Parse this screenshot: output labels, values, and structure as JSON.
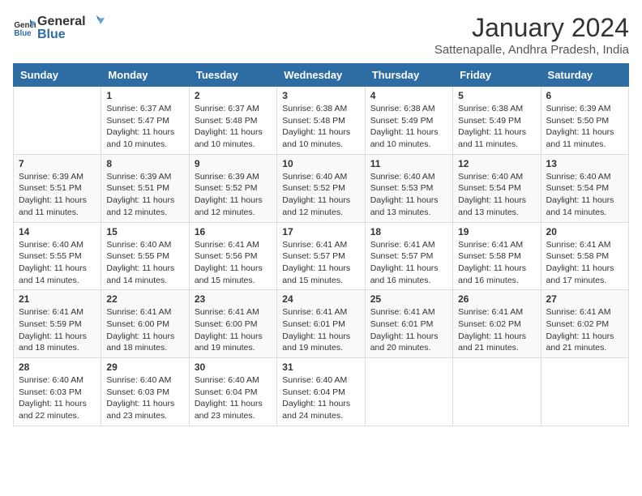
{
  "logo": {
    "text_general": "General",
    "text_blue": "Blue"
  },
  "title": "January 2024",
  "subtitle": "Sattenapalle, Andhra Pradesh, India",
  "days_of_week": [
    "Sunday",
    "Monday",
    "Tuesday",
    "Wednesday",
    "Thursday",
    "Friday",
    "Saturday"
  ],
  "weeks": [
    [
      {
        "day": "",
        "sunrise": "",
        "sunset": "",
        "daylight": ""
      },
      {
        "day": "1",
        "sunrise": "Sunrise: 6:37 AM",
        "sunset": "Sunset: 5:47 PM",
        "daylight": "Daylight: 11 hours and 10 minutes."
      },
      {
        "day": "2",
        "sunrise": "Sunrise: 6:37 AM",
        "sunset": "Sunset: 5:48 PM",
        "daylight": "Daylight: 11 hours and 10 minutes."
      },
      {
        "day": "3",
        "sunrise": "Sunrise: 6:38 AM",
        "sunset": "Sunset: 5:48 PM",
        "daylight": "Daylight: 11 hours and 10 minutes."
      },
      {
        "day": "4",
        "sunrise": "Sunrise: 6:38 AM",
        "sunset": "Sunset: 5:49 PM",
        "daylight": "Daylight: 11 hours and 10 minutes."
      },
      {
        "day": "5",
        "sunrise": "Sunrise: 6:38 AM",
        "sunset": "Sunset: 5:49 PM",
        "daylight": "Daylight: 11 hours and 11 minutes."
      },
      {
        "day": "6",
        "sunrise": "Sunrise: 6:39 AM",
        "sunset": "Sunset: 5:50 PM",
        "daylight": "Daylight: 11 hours and 11 minutes."
      }
    ],
    [
      {
        "day": "7",
        "sunrise": "Sunrise: 6:39 AM",
        "sunset": "Sunset: 5:51 PM",
        "daylight": "Daylight: 11 hours and 11 minutes."
      },
      {
        "day": "8",
        "sunrise": "Sunrise: 6:39 AM",
        "sunset": "Sunset: 5:51 PM",
        "daylight": "Daylight: 11 hours and 12 minutes."
      },
      {
        "day": "9",
        "sunrise": "Sunrise: 6:39 AM",
        "sunset": "Sunset: 5:52 PM",
        "daylight": "Daylight: 11 hours and 12 minutes."
      },
      {
        "day": "10",
        "sunrise": "Sunrise: 6:40 AM",
        "sunset": "Sunset: 5:52 PM",
        "daylight": "Daylight: 11 hours and 12 minutes."
      },
      {
        "day": "11",
        "sunrise": "Sunrise: 6:40 AM",
        "sunset": "Sunset: 5:53 PM",
        "daylight": "Daylight: 11 hours and 13 minutes."
      },
      {
        "day": "12",
        "sunrise": "Sunrise: 6:40 AM",
        "sunset": "Sunset: 5:54 PM",
        "daylight": "Daylight: 11 hours and 13 minutes."
      },
      {
        "day": "13",
        "sunrise": "Sunrise: 6:40 AM",
        "sunset": "Sunset: 5:54 PM",
        "daylight": "Daylight: 11 hours and 14 minutes."
      }
    ],
    [
      {
        "day": "14",
        "sunrise": "Sunrise: 6:40 AM",
        "sunset": "Sunset: 5:55 PM",
        "daylight": "Daylight: 11 hours and 14 minutes."
      },
      {
        "day": "15",
        "sunrise": "Sunrise: 6:40 AM",
        "sunset": "Sunset: 5:55 PM",
        "daylight": "Daylight: 11 hours and 14 minutes."
      },
      {
        "day": "16",
        "sunrise": "Sunrise: 6:41 AM",
        "sunset": "Sunset: 5:56 PM",
        "daylight": "Daylight: 11 hours and 15 minutes."
      },
      {
        "day": "17",
        "sunrise": "Sunrise: 6:41 AM",
        "sunset": "Sunset: 5:57 PM",
        "daylight": "Daylight: 11 hours and 15 minutes."
      },
      {
        "day": "18",
        "sunrise": "Sunrise: 6:41 AM",
        "sunset": "Sunset: 5:57 PM",
        "daylight": "Daylight: 11 hours and 16 minutes."
      },
      {
        "day": "19",
        "sunrise": "Sunrise: 6:41 AM",
        "sunset": "Sunset: 5:58 PM",
        "daylight": "Daylight: 11 hours and 16 minutes."
      },
      {
        "day": "20",
        "sunrise": "Sunrise: 6:41 AM",
        "sunset": "Sunset: 5:58 PM",
        "daylight": "Daylight: 11 hours and 17 minutes."
      }
    ],
    [
      {
        "day": "21",
        "sunrise": "Sunrise: 6:41 AM",
        "sunset": "Sunset: 5:59 PM",
        "daylight": "Daylight: 11 hours and 18 minutes."
      },
      {
        "day": "22",
        "sunrise": "Sunrise: 6:41 AM",
        "sunset": "Sunset: 6:00 PM",
        "daylight": "Daylight: 11 hours and 18 minutes."
      },
      {
        "day": "23",
        "sunrise": "Sunrise: 6:41 AM",
        "sunset": "Sunset: 6:00 PM",
        "daylight": "Daylight: 11 hours and 19 minutes."
      },
      {
        "day": "24",
        "sunrise": "Sunrise: 6:41 AM",
        "sunset": "Sunset: 6:01 PM",
        "daylight": "Daylight: 11 hours and 19 minutes."
      },
      {
        "day": "25",
        "sunrise": "Sunrise: 6:41 AM",
        "sunset": "Sunset: 6:01 PM",
        "daylight": "Daylight: 11 hours and 20 minutes."
      },
      {
        "day": "26",
        "sunrise": "Sunrise: 6:41 AM",
        "sunset": "Sunset: 6:02 PM",
        "daylight": "Daylight: 11 hours and 21 minutes."
      },
      {
        "day": "27",
        "sunrise": "Sunrise: 6:41 AM",
        "sunset": "Sunset: 6:02 PM",
        "daylight": "Daylight: 11 hours and 21 minutes."
      }
    ],
    [
      {
        "day": "28",
        "sunrise": "Sunrise: 6:40 AM",
        "sunset": "Sunset: 6:03 PM",
        "daylight": "Daylight: 11 hours and 22 minutes."
      },
      {
        "day": "29",
        "sunrise": "Sunrise: 6:40 AM",
        "sunset": "Sunset: 6:03 PM",
        "daylight": "Daylight: 11 hours and 23 minutes."
      },
      {
        "day": "30",
        "sunrise": "Sunrise: 6:40 AM",
        "sunset": "Sunset: 6:04 PM",
        "daylight": "Daylight: 11 hours and 23 minutes."
      },
      {
        "day": "31",
        "sunrise": "Sunrise: 6:40 AM",
        "sunset": "Sunset: 6:04 PM",
        "daylight": "Daylight: 11 hours and 24 minutes."
      },
      {
        "day": "",
        "sunrise": "",
        "sunset": "",
        "daylight": ""
      },
      {
        "day": "",
        "sunrise": "",
        "sunset": "",
        "daylight": ""
      },
      {
        "day": "",
        "sunrise": "",
        "sunset": "",
        "daylight": ""
      }
    ]
  ]
}
